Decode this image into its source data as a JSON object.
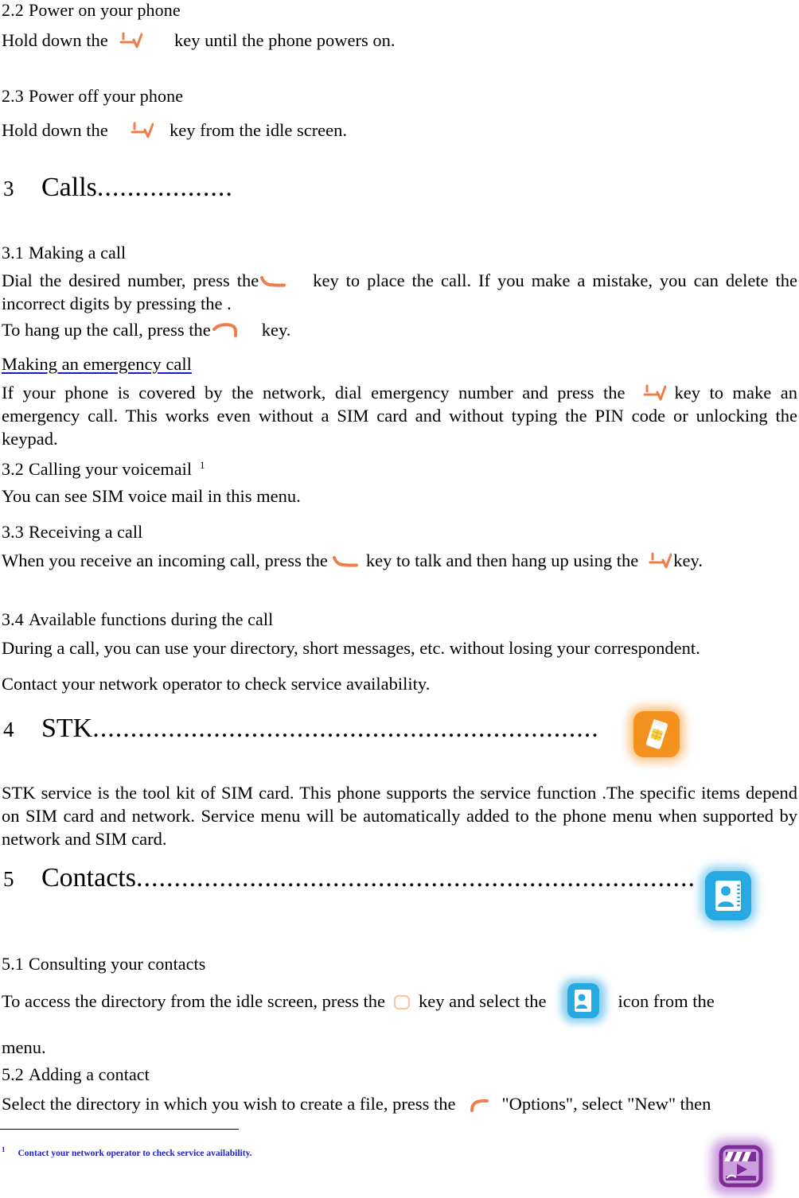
{
  "document": {
    "type": "phone-user-manual-page",
    "colors": {
      "key_orange": "#F07C4A",
      "link_blue": "#1a1ad0",
      "footnote_blue": "#2222cc",
      "stk_icon_orange": "#F5911E",
      "contacts_icon_blue": "#27A9E1",
      "video_icon_purple": "#7D2C98"
    }
  },
  "sections": {
    "s2_2": {
      "heading_num": "2.2",
      "heading_text": "Power on your phone",
      "body_before": "Hold down the",
      "body_after": "key until the phone powers on."
    },
    "s2_3": {
      "heading_num": "2.3",
      "heading_text": "Power off your phone",
      "body_before": "Hold down the",
      "body_after": "key from the idle screen."
    },
    "chapter3": {
      "number": "3",
      "title": "Calls",
      "dots": ".................."
    },
    "s3_1": {
      "heading_num": "3.1",
      "heading_text": "Making a call",
      "p1_before": "Dial the desired number, press the",
      "p1_after": "key to place the call. If you make a mistake, you can delete the incorrect digits by pressing the .",
      "p2_before": "To hang up the call, press the",
      "p2_after": "key.",
      "emergency_link": "Making an emergency call",
      "p3_before": "If your phone is covered by the network, dial emergency number and press the",
      "p3_after": "key to make an emergency call. This works even without a SIM card and without typing the PIN code or unlocking the keypad."
    },
    "s3_2": {
      "heading_num": "3.2",
      "heading_text": "Calling your voicemail",
      "footnote_marker": "1",
      "body": "You can see SIM voice mail in this menu."
    },
    "s3_3": {
      "heading_num": "3.3",
      "heading_text": "Receiving a call",
      "p_before": "When you receive an incoming call, press the",
      "p_mid": "key to talk and then hang up using the",
      "p_after": "key."
    },
    "s3_4": {
      "heading_num": "3.4",
      "heading_text": "Available functions during the call",
      "p1": "During a call, you can use your directory, short messages, etc. without losing your correspondent.",
      "p2": "Contact your network operator to check service availability."
    },
    "chapter4": {
      "number": "4",
      "title": "STK",
      "dots": "...................................................................",
      "icon": "stk-sim-toolkit-icon",
      "body": "STK service is the tool kit of SIM card. This phone supports the service function .The specific items depend on SIM card and network. Service menu will be automatically added to the phone menu when supported by network and SIM card."
    },
    "chapter5": {
      "number": "5",
      "title": "Contacts",
      "dots": "..........................................................................",
      "icon": "contacts-address-book-icon"
    },
    "s5_1": {
      "heading_num": "5.1",
      "heading_text": "Consulting your contacts",
      "p_before": "To access the directory from the idle screen, press the",
      "p_mid": "key and select the",
      "p_after": "icon from the",
      "p_tail": "menu."
    },
    "s5_2": {
      "heading_num": "5.2",
      "heading_text": "Adding a contact",
      "p_before": "Select the directory in which you wish to create a file, press the",
      "p_after": "\"Options\", select \"New\" then"
    }
  },
  "footnote": {
    "marker": "1",
    "text": "Contact your network operator to check service availability."
  },
  "icons": {
    "power_key": "power-end-call-key-icon",
    "send_key": "send-call-key-icon",
    "hangup_key": "hangup-key-icon",
    "ok_key": "ok-center-key-icon",
    "left_soft_key": "left-soft-key-icon",
    "stk": "stk-sim-toolkit-icon",
    "contacts": "contacts-address-book-icon",
    "video": "video-player-icon"
  }
}
